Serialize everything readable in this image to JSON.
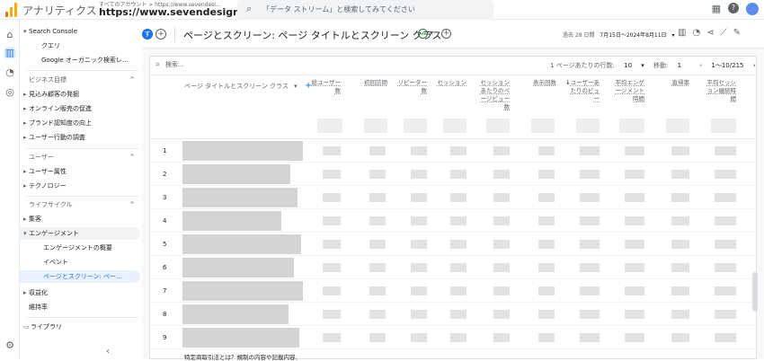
{
  "app": {
    "name": "アナリティクス",
    "account_line": "すべてのアカウント > https://www.sevendesi...",
    "property": "https://www.sevendesign.bi...",
    "search_placeholder": "「データ ストリーム」と検索してみてください",
    "brand_colors": {
      "logo_orange": "#f9ab00",
      "logo_dark": "#e37400",
      "accent": "#1a73e8"
    }
  },
  "top_icons": [
    "apps-grid-icon",
    "help-icon",
    "avatar"
  ],
  "rail": [
    "home-icon",
    "reports-icon",
    "explore-icon",
    "advertising-icon",
    "settings-icon"
  ],
  "sidebar": {
    "search_console": "Search Console",
    "sc_query": "クエリ",
    "sc_google": "Google オーガニック検索レ...",
    "section_business": "ビジネス目標",
    "business_items": [
      "見込み顧客の発掘",
      "オンライン販売の促進",
      "ブランド認知度の向上",
      "ユーザー行動の調査"
    ],
    "section_user": "ユーザー",
    "user_items": [
      "ユーザー属性",
      "テクノロジー"
    ],
    "section_lifecycle": "ライフサイクル",
    "lifecycle_items": [
      "集客",
      "エンゲージメント"
    ],
    "engagement_sub": [
      "エンゲージメントの概要",
      "イベント",
      "ページとスクリーン: ペー..."
    ],
    "after_items": [
      "収益化",
      "維持率"
    ],
    "library": "ライブラリ"
  },
  "header": {
    "compare_chip": "す",
    "title": "ページとスクリーン: ページ タイトルとスクリーン クラス",
    "date_label": "過去 28 日間",
    "date_value": "7月15日～2024年8月11日",
    "date_caret": "▾"
  },
  "table": {
    "search_placeholder": "検索...",
    "rows_per_page_label": "1 ページあたりの行数:",
    "rows_per_page": "10",
    "goto_label": "移動:",
    "goto_value": "1",
    "range": "1～10/215",
    "dimension_header": "ページ タイトルとスクリーン クラス",
    "metric_headers": [
      "総ユーザー数",
      "初回訪問",
      "リピーター数",
      "セッション",
      "セッションあたりのページビュー数",
      "表示回数",
      "ユーザーあたりのビュー",
      "平均エンゲージメント時間",
      "直帰率",
      "平均セッション継続時間"
    ],
    "row_numbers": [
      "1",
      "2",
      "3",
      "4",
      "5",
      "6",
      "7",
      "8",
      "9"
    ],
    "footer_text": "特定商取引法とは？規制の内容や記載内容、"
  }
}
